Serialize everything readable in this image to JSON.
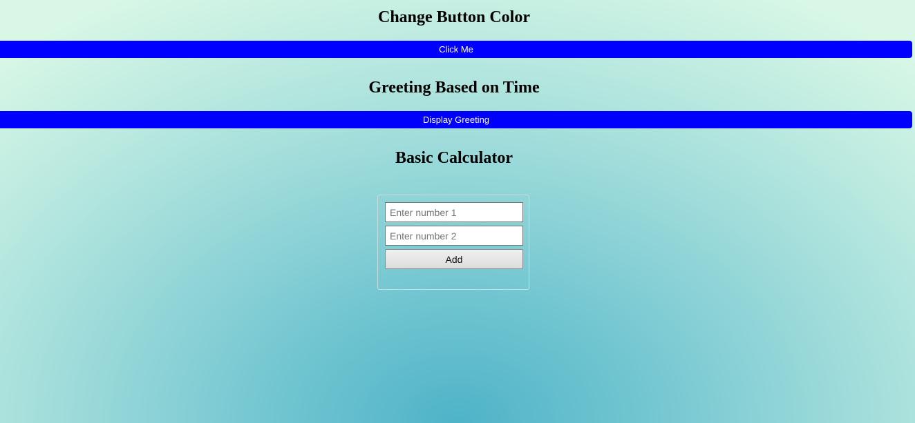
{
  "change_color": {
    "title": "Change Button Color",
    "button_label": "Click Me",
    "button_color": "#0000ff"
  },
  "greeting": {
    "title": "Greeting Based on Time",
    "button_label": "Display Greeting",
    "button_color": "#0000ff"
  },
  "calculator": {
    "title": "Basic Calculator",
    "input1": {
      "value": "",
      "placeholder": "Enter number 1"
    },
    "input2": {
      "value": "",
      "placeholder": "Enter number 2"
    },
    "add_label": "Add"
  }
}
